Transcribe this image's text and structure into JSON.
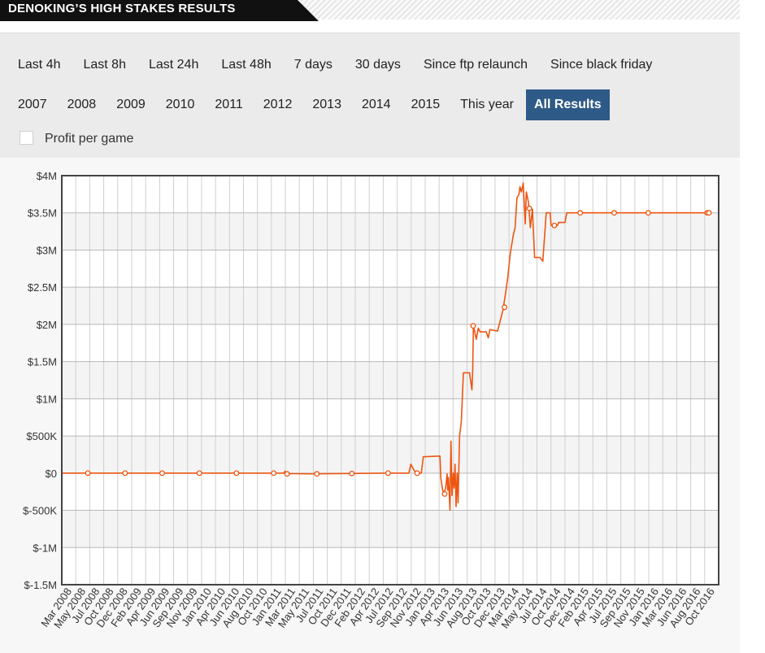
{
  "header": {
    "title": "DENOKING’S HIGH STAKES RESULTS"
  },
  "filters": {
    "row1": [
      "Last 4h",
      "Last 8h",
      "Last 24h",
      "Last 48h",
      "7 days",
      "30 days",
      "Since ftp relaunch",
      "Since black friday"
    ],
    "row2": [
      "2007",
      "2008",
      "2009",
      "2010",
      "2011",
      "2012",
      "2013",
      "2014",
      "2015",
      "This year",
      "All Results"
    ],
    "active": "All Results",
    "profit_per_game_label": "Profit per game",
    "profit_per_game_checked": false
  },
  "colors": {
    "line": "#ee5511",
    "active_button": "#2e5a87",
    "header": "#111111"
  },
  "chart_data": {
    "type": "line",
    "title": "",
    "xlabel": "",
    "ylabel": "",
    "ylim": [
      -1500000,
      4000000
    ],
    "y_ticks": [
      {
        "value": 4000000,
        "label": "$4M"
      },
      {
        "value": 3500000,
        "label": "$3.5M"
      },
      {
        "value": 3000000,
        "label": "$3M"
      },
      {
        "value": 2500000,
        "label": "$2.5M"
      },
      {
        "value": 2000000,
        "label": "$2M"
      },
      {
        "value": 1500000,
        "label": "$1.5M"
      },
      {
        "value": 1000000,
        "label": "$1M"
      },
      {
        "value": 500000,
        "label": "$500K"
      },
      {
        "value": 0,
        "label": "$0"
      },
      {
        "value": -500000,
        "label": "$-500K"
      },
      {
        "value": -1000000,
        "label": "$-1M"
      },
      {
        "value": -1500000,
        "label": "$-1.5M"
      }
    ],
    "x_labels": [
      "Mar 2008",
      "May 2008",
      "Jul 2008",
      "Oct 2008",
      "Dec 2008",
      "Feb 2009",
      "Apr 2009",
      "Jun 2009",
      "Sep 2009",
      "Nov 2009",
      "Jan 2010",
      "Apr 2010",
      "Jun 2010",
      "Aug 2010",
      "Oct 2010",
      "Jan 2011",
      "Mar 2011",
      "May 2011",
      "Jul 2011",
      "Oct 2011",
      "Dec 2011",
      "Feb 2012",
      "Apr 2012",
      "Jul 2012",
      "Sep 2012",
      "Nov 2012",
      "Jan 2013",
      "Apr 2013",
      "Jun 2013",
      "Aug 2013",
      "Oct 2013",
      "Dec 2013",
      "Mar 2014",
      "May 2014",
      "Jul 2014",
      "Oct 2014",
      "Dec 2014",
      "Feb 2015",
      "Apr 2015",
      "Jul 2015",
      "Sep 2015",
      "Nov 2015",
      "Jan 2016",
      "Mar 2016",
      "Jun 2016",
      "Aug 2016",
      "Oct 2016"
    ],
    "grid": true,
    "series": [
      {
        "name": "",
        "points": [
          [
            "2008-01-25",
            0
          ],
          [
            "2008-12-01",
            0
          ],
          [
            "2009-11-01",
            0
          ],
          [
            "2010-10-01",
            0
          ],
          [
            "2011-01-20",
            0
          ],
          [
            "2011-01-25",
            25000
          ],
          [
            "2011-02-01",
            -5000
          ],
          [
            "2011-03-01",
            -8000
          ],
          [
            "2011-06-15",
            -10000
          ],
          [
            "2011-12-01",
            -5000
          ],
          [
            "2012-06-01",
            0
          ],
          [
            "2012-09-25",
            0
          ],
          [
            "2012-10-05",
            120000
          ],
          [
            "2012-10-20",
            40000
          ],
          [
            "2012-11-01",
            0
          ],
          [
            "2012-11-25",
            0
          ],
          [
            "2012-12-05",
            220000
          ],
          [
            "2013-02-25",
            230000
          ],
          [
            "2013-03-01",
            -60000
          ],
          [
            "2013-03-08",
            -200000
          ],
          [
            "2013-03-15",
            -280000
          ],
          [
            "2013-03-25",
            -200000
          ],
          [
            "2013-04-01",
            -10000
          ],
          [
            "2013-04-04",
            -230000
          ],
          [
            "2013-04-08",
            -60000
          ],
          [
            "2013-04-15",
            -500000
          ],
          [
            "2013-04-20",
            430000
          ],
          [
            "2013-04-25",
            -300000
          ],
          [
            "2013-05-01",
            0
          ],
          [
            "2013-05-05",
            -200000
          ],
          [
            "2013-05-10",
            120000
          ],
          [
            "2013-05-15",
            -450000
          ],
          [
            "2013-05-20",
            0
          ],
          [
            "2013-05-25",
            -400000
          ],
          [
            "2013-06-01",
            500000
          ],
          [
            "2013-06-10",
            700000
          ],
          [
            "2013-06-20",
            1350000
          ],
          [
            "2013-07-20",
            1350000
          ],
          [
            "2013-08-01",
            1120000
          ],
          [
            "2013-08-05",
            1400000
          ],
          [
            "2013-08-08",
            1980000
          ],
          [
            "2013-08-15",
            1900000
          ],
          [
            "2013-08-22",
            1800000
          ],
          [
            "2013-09-01",
            1950000
          ],
          [
            "2013-09-10",
            1900000
          ],
          [
            "2013-10-10",
            1900000
          ],
          [
            "2013-10-20",
            1820000
          ],
          [
            "2013-10-28",
            1930000
          ],
          [
            "2013-12-05",
            1910000
          ],
          [
            "2014-01-01",
            2200000
          ],
          [
            "2014-01-15",
            2450000
          ],
          [
            "2014-01-25",
            2650000
          ],
          [
            "2014-02-05",
            2950000
          ],
          [
            "2014-02-20",
            3200000
          ],
          [
            "2014-03-01",
            3300000
          ],
          [
            "2014-03-10",
            3700000
          ],
          [
            "2014-03-20",
            3750000
          ],
          [
            "2014-03-25",
            3850000
          ],
          [
            "2014-04-01",
            3780000
          ],
          [
            "2014-04-10",
            3900000
          ],
          [
            "2014-04-20",
            3350000
          ],
          [
            "2014-04-25",
            3780000
          ],
          [
            "2014-05-05",
            3650000
          ],
          [
            "2014-05-15",
            3300000
          ],
          [
            "2014-05-25",
            3550000
          ],
          [
            "2014-06-05",
            2900000
          ],
          [
            "2014-07-01",
            2900000
          ],
          [
            "2014-07-15",
            2850000
          ],
          [
            "2014-08-01",
            3500000
          ],
          [
            "2014-08-20",
            3500000
          ],
          [
            "2014-08-25",
            3330000
          ],
          [
            "2014-09-25",
            3330000
          ],
          [
            "2014-10-01",
            3370000
          ],
          [
            "2014-11-01",
            3370000
          ],
          [
            "2014-11-10",
            3500000
          ],
          [
            "2016-09-01",
            3500000
          ],
          [
            "2016-10-10",
            3500000
          ]
        ],
        "markers": [
          [
            "2008-06-01",
            0
          ],
          [
            "2008-12-01",
            0
          ],
          [
            "2009-06-01",
            0
          ],
          [
            "2009-12-01",
            0
          ],
          [
            "2010-06-01",
            0
          ],
          [
            "2010-12-01",
            0
          ],
          [
            "2011-02-05",
            -10000
          ],
          [
            "2011-07-01",
            -10000
          ],
          [
            "2011-12-20",
            -5000
          ],
          [
            "2012-06-15",
            0
          ],
          [
            "2012-11-05",
            0
          ],
          [
            "2013-03-20",
            -280000
          ],
          [
            "2013-08-07",
            1980000
          ],
          [
            "2014-01-08",
            2230000
          ],
          [
            "2014-05-10",
            3560000
          ],
          [
            "2014-09-10",
            3330000
          ],
          [
            "2015-01-15",
            3500000
          ],
          [
            "2015-07-01",
            3500000
          ],
          [
            "2015-12-15",
            3500000
          ],
          [
            "2016-09-30",
            3500000
          ],
          [
            "2016-10-08",
            3500000
          ]
        ]
      }
    ]
  }
}
